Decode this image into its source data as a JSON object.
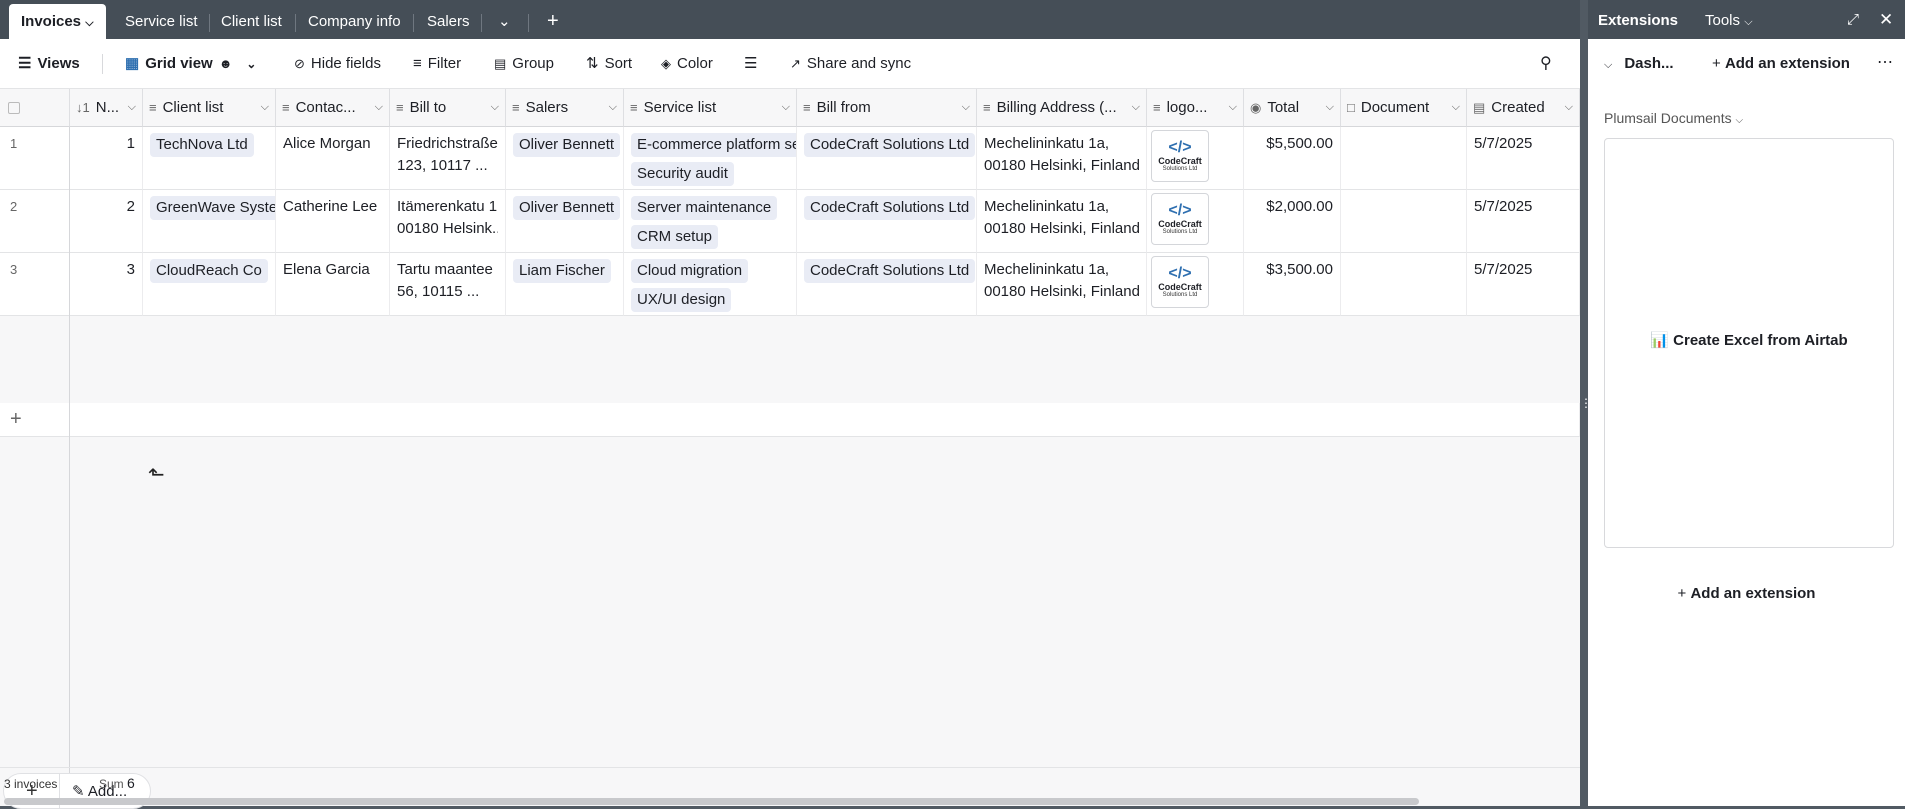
{
  "tabs": [
    {
      "label": "Invoices"
    },
    {
      "label": "Service list"
    },
    {
      "label": "Client list"
    },
    {
      "label": "Company info"
    },
    {
      "label": "Salers"
    }
  ],
  "toolbar": {
    "views": "Views",
    "grid_view": "Grid view",
    "hide_fields": "Hide fields",
    "filter": "Filter",
    "group": "Group",
    "sort": "Sort",
    "color": "Color",
    "share": "Share and sync"
  },
  "columns": [
    "N...",
    "Client list",
    "Contac...",
    "Bill to",
    "Salers",
    "Service list",
    "Bill from",
    "Billing Address (...",
    "logo...",
    "Total",
    "Document",
    "Created"
  ],
  "rows": [
    {
      "row": "1",
      "n": "1",
      "client": "TechNova Ltd",
      "contact": "Alice Morgan",
      "bill_to_1": "Friedrichstraße",
      "bill_to_2": "123, 10117 ...",
      "saler": "Oliver Bennett",
      "service_1": "E-commerce platform se",
      "service_2": "Security audit",
      "bill_from": "CodeCraft Solutions Ltd",
      "addr_1": "Mechelininkatu 1a,",
      "addr_2": "00180 Helsinki, Finland",
      "total": "$5,500.00",
      "document": "",
      "created": "5/7/2025"
    },
    {
      "row": "2",
      "n": "2",
      "client": "GreenWave Systen",
      "contact": "Catherine Lee",
      "bill_to_1": "Itämerenkatu 1,",
      "bill_to_2": "00180 Helsink...",
      "saler": "Oliver Bennett",
      "service_1": "Server maintenance",
      "service_2": "CRM setup",
      "bill_from": "CodeCraft Solutions Ltd",
      "addr_1": "Mechelininkatu 1a,",
      "addr_2": "00180 Helsinki, Finland",
      "total": "$2,000.00",
      "document": "",
      "created": "5/7/2025"
    },
    {
      "row": "3",
      "n": "3",
      "client": "CloudReach Co",
      "contact": "Elena Garcia",
      "bill_to_1": "Tartu maantee",
      "bill_to_2": "56, 10115 ...",
      "saler": "Liam Fischer",
      "service_1": "Cloud migration",
      "service_2": "UX/UI design",
      "bill_from": "CodeCraft Solutions Ltd",
      "addr_1": "Mechelininkatu 1a,",
      "addr_2": "00180 Helsinki, Finland",
      "total": "$3,500.00",
      "document": "",
      "created": "5/7/2025"
    }
  ],
  "logo": {
    "code": "</>",
    "line1": "CodeCraft",
    "line2": "Solutions Ltd"
  },
  "footer": {
    "add_label": "Add...",
    "count": "3 invoices",
    "sum_label": "Sum",
    "sum_value": "6"
  },
  "sidebar": {
    "extensions": "Extensions",
    "tools": "Tools",
    "dashboard": "Dash...",
    "add_extension": "Add an extension",
    "plumsail": "Plumsail Documents",
    "create_excel": "Create Excel from Airtab",
    "add_extension_bottom": "Add an extension"
  },
  "colors": {
    "topbar": "#454e57",
    "accent": "#2e6fb0"
  }
}
